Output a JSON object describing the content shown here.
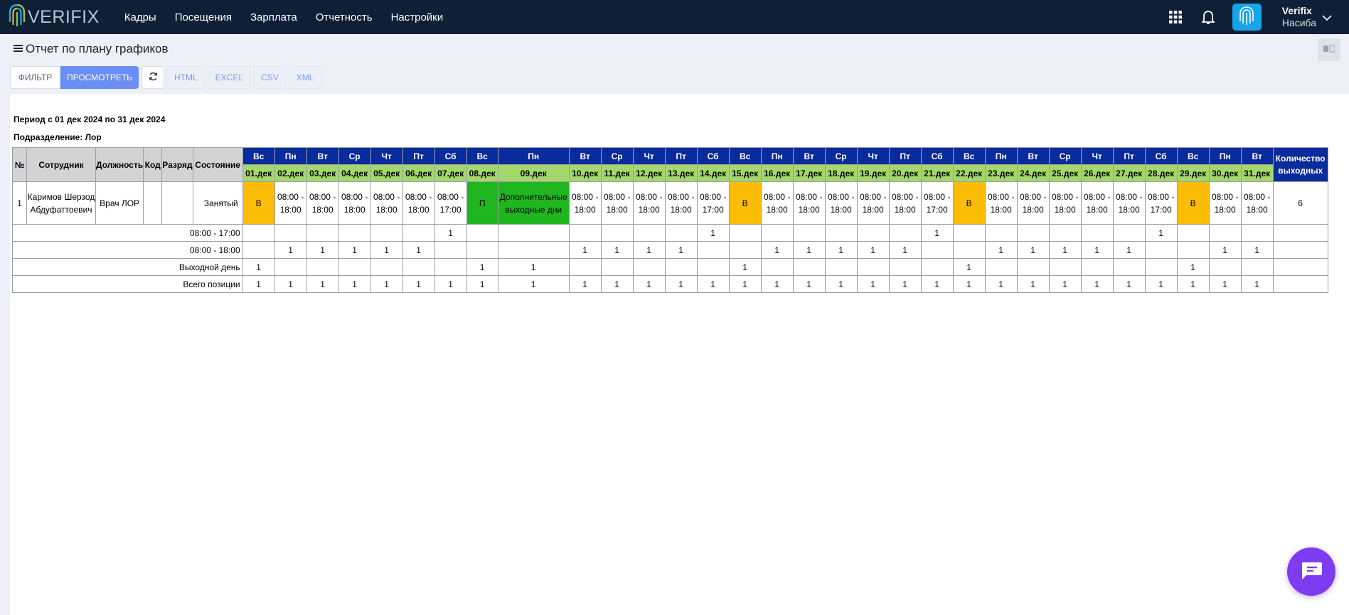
{
  "brand": {
    "logo_text": "VERIFIX"
  },
  "nav": [
    "Кадры",
    "Посещения",
    "Зарплата",
    "Отчетность",
    "Настройки"
  ],
  "user": {
    "name": "Verifix",
    "sub": "Насиба"
  },
  "page": {
    "title": "Отчет по плану графиков"
  },
  "toolbar": {
    "filter": "ФИЛЬТР",
    "view": "ПРОСМОТРЕТЬ",
    "html": "HTML",
    "excel": "EXCEL",
    "csv": "CSV",
    "xml": "XML"
  },
  "report": {
    "period": "Период с 01 дек 2024 по 31 дек 2024",
    "department": "Подразделение: Лор",
    "headers": {
      "num": "№",
      "employee": "Сотрудник",
      "position": "Должность",
      "code": "Код",
      "grade": "Разряд",
      "status": "Состояние",
      "count": "Количество выходных"
    },
    "days": [
      {
        "dow": "Вс",
        "date": "01.дек"
      },
      {
        "dow": "Пн",
        "date": "02.дек"
      },
      {
        "dow": "Вт",
        "date": "03.дек"
      },
      {
        "dow": "Ср",
        "date": "04.дек"
      },
      {
        "dow": "Чт",
        "date": "05.дек"
      },
      {
        "dow": "Пт",
        "date": "06.дек"
      },
      {
        "dow": "Сб",
        "date": "07.дек"
      },
      {
        "dow": "Вс",
        "date": "08.дек"
      },
      {
        "dow": "Пн",
        "date": "09.дек"
      },
      {
        "dow": "Вт",
        "date": "10.дек"
      },
      {
        "dow": "Ср",
        "date": "11.дек"
      },
      {
        "dow": "Чт",
        "date": "12.дек"
      },
      {
        "dow": "Пт",
        "date": "13.дек"
      },
      {
        "dow": "Сб",
        "date": "14.дек"
      },
      {
        "dow": "Вс",
        "date": "15.дек"
      },
      {
        "dow": "Пн",
        "date": "16.дек"
      },
      {
        "dow": "Вт",
        "date": "17.дек"
      },
      {
        "dow": "Ср",
        "date": "18.дек"
      },
      {
        "dow": "Чт",
        "date": "19.дек"
      },
      {
        "dow": "Пт",
        "date": "20.дек"
      },
      {
        "dow": "Сб",
        "date": "21.дек"
      },
      {
        "dow": "Вс",
        "date": "22.дек"
      },
      {
        "dow": "Пн",
        "date": "23.дек"
      },
      {
        "dow": "Вт",
        "date": "24.дек"
      },
      {
        "dow": "Ср",
        "date": "25.дек"
      },
      {
        "dow": "Чт",
        "date": "26.дек"
      },
      {
        "dow": "Пт",
        "date": "27.дек"
      },
      {
        "dow": "Сб",
        "date": "28.дек"
      },
      {
        "dow": "Вс",
        "date": "29.дек"
      },
      {
        "dow": "Пн",
        "date": "30.дек"
      },
      {
        "dow": "Вт",
        "date": "31.дек"
      }
    ],
    "employee": {
      "num": "1",
      "name": "Каримов Шерзод Абдуфаттоевич",
      "position": "Врач ЛОР",
      "code": "",
      "grade": "",
      "status": "Занятый",
      "cells": [
        {
          "text": "В",
          "kind": "w"
        },
        {
          "text": "08:00 - 18:00",
          "kind": ""
        },
        {
          "text": "08:00 - 18:00",
          "kind": ""
        },
        {
          "text": "08:00 - 18:00",
          "kind": ""
        },
        {
          "text": "08:00 - 18:00",
          "kind": ""
        },
        {
          "text": "08:00 - 18:00",
          "kind": ""
        },
        {
          "text": "08:00 - 17:00",
          "kind": ""
        },
        {
          "text": "П",
          "kind": "p"
        },
        {
          "text": "Дополнительные выходные дни",
          "kind": "p"
        },
        {
          "text": "08:00 - 18:00",
          "kind": ""
        },
        {
          "text": "08:00 - 18:00",
          "kind": ""
        },
        {
          "text": "08:00 - 18:00",
          "kind": ""
        },
        {
          "text": "08:00 - 18:00",
          "kind": ""
        },
        {
          "text": "08:00 - 17:00",
          "kind": ""
        },
        {
          "text": "В",
          "kind": "w"
        },
        {
          "text": "08:00 - 18:00",
          "kind": ""
        },
        {
          "text": "08:00 - 18:00",
          "kind": ""
        },
        {
          "text": "08:00 - 18:00",
          "kind": ""
        },
        {
          "text": "08:00 - 18:00",
          "kind": ""
        },
        {
          "text": "08:00 - 18:00",
          "kind": ""
        },
        {
          "text": "08:00 - 17:00",
          "kind": ""
        },
        {
          "text": "В",
          "kind": "w"
        },
        {
          "text": "08:00 - 18:00",
          "kind": ""
        },
        {
          "text": "08:00 - 18:00",
          "kind": ""
        },
        {
          "text": "08:00 - 18:00",
          "kind": ""
        },
        {
          "text": "08:00 - 18:00",
          "kind": ""
        },
        {
          "text": "08:00 - 18:00",
          "kind": ""
        },
        {
          "text": "08:00 - 17:00",
          "kind": ""
        },
        {
          "text": "В",
          "kind": "w"
        },
        {
          "text": "08:00 - 18:00",
          "kind": ""
        },
        {
          "text": "08:00 - 18:00",
          "kind": ""
        }
      ],
      "weekend_count": "6"
    },
    "summary": [
      {
        "label": "08:00 - 17:00",
        "values": [
          "",
          "",
          "",
          "",
          "",
          "",
          "1",
          "",
          "",
          "",
          "",
          "",
          "",
          "1",
          "",
          "",
          "",
          "",
          "",
          "",
          "1",
          "",
          "",
          "",
          "",
          "",
          "",
          "1",
          "",
          "",
          ""
        ]
      },
      {
        "label": "08:00 - 18:00",
        "values": [
          "",
          "1",
          "1",
          "1",
          "1",
          "1",
          "",
          "",
          "",
          "1",
          "1",
          "1",
          "1",
          "",
          "",
          "1",
          "1",
          "1",
          "1",
          "1",
          "",
          "",
          "1",
          "1",
          "1",
          "1",
          "1",
          "",
          "",
          "1",
          "1"
        ]
      },
      {
        "label": "Выходной день",
        "values": [
          "1",
          "",
          "",
          "",
          "",
          "",
          "",
          "1",
          "1",
          "",
          "",
          "",
          "",
          "",
          "1",
          "",
          "",
          "",
          "",
          "",
          "",
          "1",
          "",
          "",
          "",
          "",
          "",
          "",
          "1",
          "",
          ""
        ]
      },
      {
        "label": "Всего позиции",
        "values": [
          "1",
          "1",
          "1",
          "1",
          "1",
          "1",
          "1",
          "1",
          "1",
          "1",
          "1",
          "1",
          "1",
          "1",
          "1",
          "1",
          "1",
          "1",
          "1",
          "1",
          "1",
          "1",
          "1",
          "1",
          "1",
          "1",
          "1",
          "1",
          "1",
          "1",
          "1"
        ]
      }
    ]
  },
  "colors": {
    "nav_bg": "#0f1f36",
    "accent": "#6b8ef5",
    "header_blue": "#0a2b9b",
    "date_green": "#a5d86a",
    "weekend": "#fbbd08",
    "holiday": "#1fb61f",
    "chat": "#7d3cf0"
  }
}
